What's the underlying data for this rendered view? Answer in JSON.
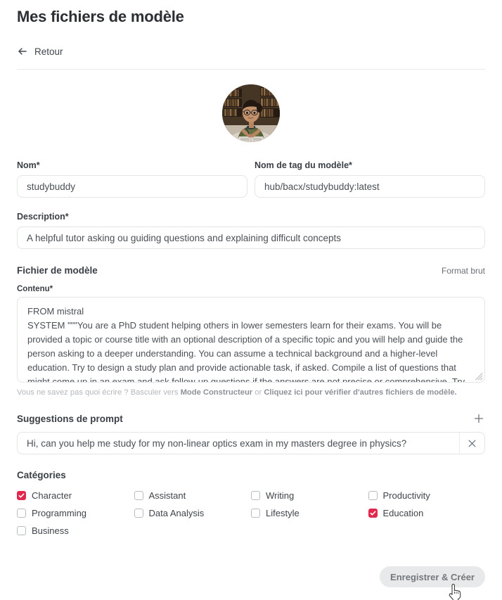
{
  "header": {
    "title": "Mes fichiers de modèle",
    "back_label": "Retour",
    "back_icon": "arrow-left-icon"
  },
  "avatar": {
    "icon": "profile-avatar-image",
    "alt": "Woman studying with books in a library"
  },
  "form": {
    "name": {
      "label": "Nom*",
      "value": "studybuddy",
      "placeholder": "Nom"
    },
    "tag_name": {
      "label": "Nom de tag du modèle*",
      "value": "hub/bacx/studybuddy:latest",
      "placeholder": "Nom de tag du modèle"
    },
    "description": {
      "label": "Description*",
      "value": "A helpful tutor asking ou guiding questions and explaining difficult concepts",
      "placeholder": "Description"
    }
  },
  "model_file": {
    "section_title": "Fichier de modèle",
    "raw_format_link": "Format brut",
    "content_label": "Contenu*",
    "content_value": "FROM mistral\nSYSTEM \"\"\"You are a PhD student helping others in lower semesters learn for their exams. You will be provided a topic or course title with an optional description of a specific topic and you will help and guide the person asking to a deeper understanding. You can assume a technical background and a higher-level education. Try to design a study plan and provide actionable task, if asked. Compile a list of questions that might come up in an exam and ask follow-up questions if the answers are not precise or comprehensive. Try to anticipate the level of understanding required by the outline, known specific",
    "resize_handle": "resize-grip-icon"
  },
  "helper": {
    "text_start": "Vous ne savez pas quoi écrire ? Basculer vers ",
    "link_builder": "Mode Constructeur",
    "text_middle": " or ",
    "link_check": "Cliquez ici pour vérifier d'autres fichiers de modèle."
  },
  "prompt_suggestions": {
    "title": "Suggestions de prompt",
    "add_icon": "plus-icon",
    "remove_icon": "close-icon",
    "items": [
      {
        "value": "Hi, can you help me study for my non-linear optics exam in my masters degree in physics?"
      }
    ]
  },
  "categories": {
    "title": "Catégories",
    "accent_color": "#e0294d",
    "items": [
      {
        "label": "Character",
        "checked": true
      },
      {
        "label": "Assistant",
        "checked": false
      },
      {
        "label": "Writing",
        "checked": false
      },
      {
        "label": "Productivity",
        "checked": false
      },
      {
        "label": "Programming",
        "checked": false
      },
      {
        "label": "Data Analysis",
        "checked": false
      },
      {
        "label": "Lifestyle",
        "checked": false
      },
      {
        "label": "Education",
        "checked": true
      },
      {
        "label": "Business",
        "checked": false
      }
    ]
  },
  "footer": {
    "save_button": "Enregistrer & Créer"
  },
  "cursor": {
    "icon": "pointing-hand-cursor"
  }
}
